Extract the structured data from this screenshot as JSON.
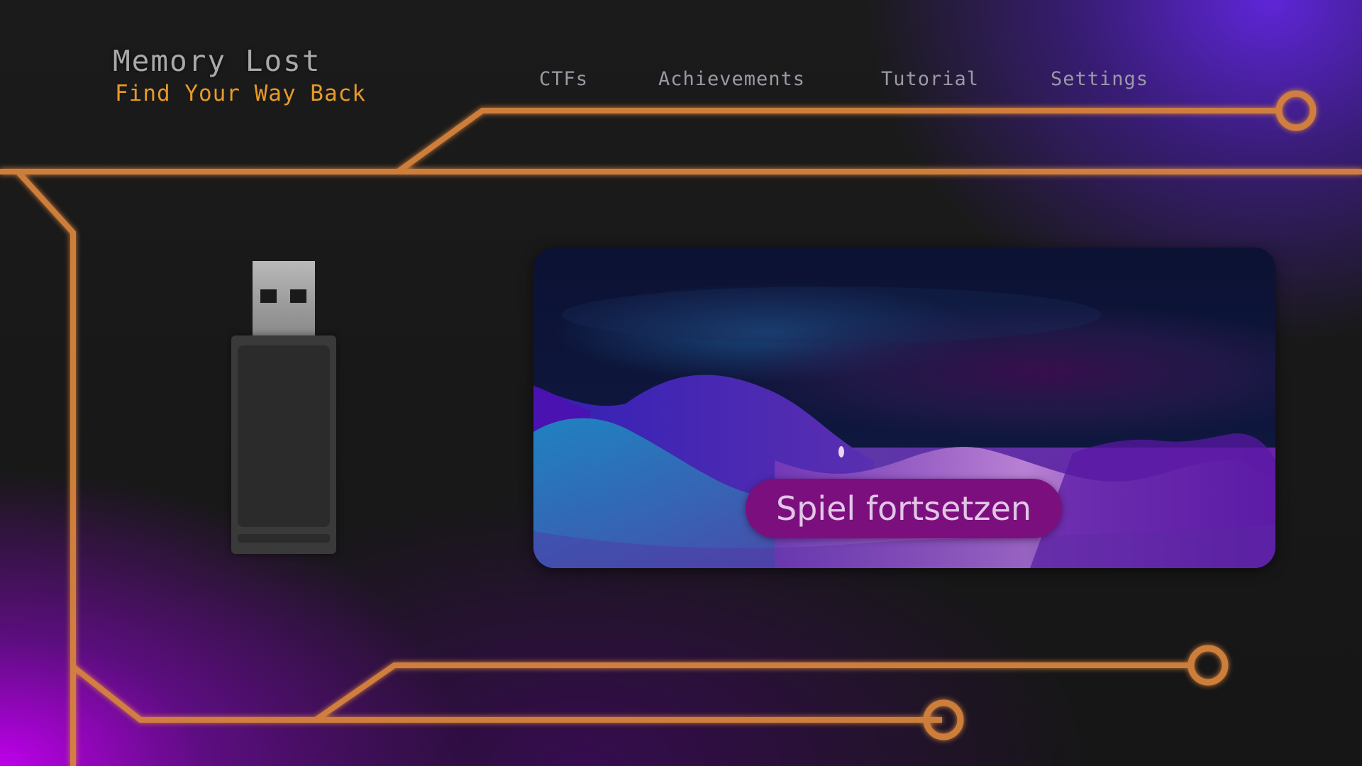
{
  "app": {
    "title": "Memory Lost",
    "subtitle": "Find Your Way Back"
  },
  "nav": {
    "items": [
      "CTFs",
      "Achievements",
      "Tutorial",
      "Settings"
    ]
  },
  "main": {
    "continue_label": "Spiel fortsetzen"
  },
  "icons": {
    "usb": "usb-stick-icon"
  },
  "colors": {
    "circuit": "#d8843e",
    "title": "#a9a9a9",
    "subtitle": "#e79a2a",
    "nav_text": "#9a9aa6",
    "button_bg": "#7c0f7e",
    "button_text": "#e1c7e6",
    "glow_purple": "#5f22e0",
    "glow_magenta": "#bd00ea"
  }
}
